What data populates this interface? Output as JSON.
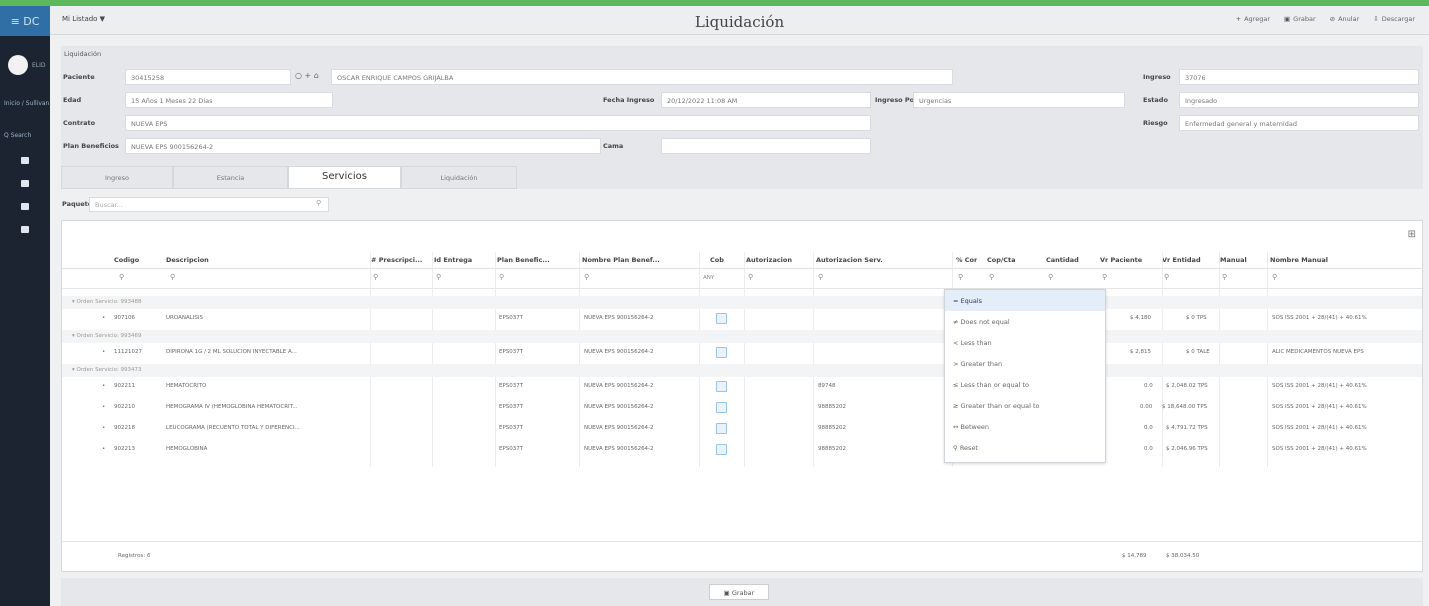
{
  "sidebar": {
    "menu_label": "≡  DC",
    "user": "ELID",
    "links": [
      "Inicio / Sullivan",
      "Q  Search"
    ]
  },
  "titlebar": {
    "left_label": "Mi Listado ▼",
    "title": "Liquidación",
    "actions": [
      "Agregar",
      "Grabar",
      "Anular",
      "Descargar"
    ]
  },
  "form": {
    "panel_title": "Liquidación",
    "labels": {
      "paciente": "Paciente",
      "edad": "Edad",
      "contrato": "Contrato",
      "plan": "Plan Beneficios",
      "fecha_ingreso": "Fecha Ingreso",
      "ingreso_por": "Ingreso Por",
      "cama": "Cama",
      "ingreso": "Ingreso",
      "estado": "Estado",
      "riesgo": "Riesgo"
    },
    "values": {
      "paciente_id": "30415258",
      "paciente_name": "OSCAR ENRIQUE CAMPOS GRIJALBA",
      "edad": "15 Años 1 Meses 22 Días",
      "contrato": "NUEVA EPS",
      "plan": "NUEVA EPS 900156264-2",
      "fecha_ingreso": "20/12/2022 11:08 AM",
      "ingreso_por": "Urgencias",
      "cama": "",
      "ingreso": "37076",
      "estado": "Ingresado",
      "riesgo": "Enfermedad general y maternidad"
    }
  },
  "tabs": [
    "Ingreso",
    "Estancia",
    "Servicios",
    "Liquidación"
  ],
  "search": {
    "label": "Paquete",
    "placeholder": "Buscar..."
  },
  "grid": {
    "columns": [
      "Codigo",
      "Descripcion",
      "# Prescripci...",
      "Id Entrega",
      "Plan Benefic...",
      "Nombre Plan Benef...",
      "Cob",
      "Autorizacion",
      "Autorizacion Serv.",
      "% Cor",
      "Cop/Cta",
      "Cantidad",
      "Vr Paciente",
      "Vr Entidad",
      "Manual",
      "Nombre Manual"
    ],
    "cob_filter": "ANY",
    "groups": [
      {
        "title": "Orden Servicio: 993488",
        "rows": [
          {
            "codigo": "907106",
            "descripcion": "UROANALISIS",
            "plan": "EPS037T",
            "nombre_plan": "NUEVA EPS 900156264-2",
            "autorizacion_serv": "",
            "vr_paciente": "$ 4,180",
            "vr_entidad": "$ 0 TPS",
            "nombre_manual": "SOS ISS 2001 + 28/(41) + 40.61%"
          }
        ]
      },
      {
        "title": "Orden Servicio: 993469",
        "rows": [
          {
            "codigo": "11121027",
            "descripcion": "DIPIRONA 1G / 2 ML SOLUCION INYECTABLE A...",
            "plan": "EPS037T",
            "nombre_plan": "NUEVA EPS 900156264-2",
            "autorizacion_serv": "",
            "vr_paciente": "$ 2,815",
            "vr_entidad": "$ 0 TALE",
            "nombre_manual": "ALIC MEDICAMENTOS NUEVA EPS"
          }
        ]
      },
      {
        "title": "Orden Servicio: 993473",
        "rows": [
          {
            "codigo": "902211",
            "descripcion": "HEMATOCRITO",
            "plan": "EPS037T",
            "nombre_plan": "NUEVA EPS 900156264-2",
            "autorizacion_serv": "89748",
            "cantidad": "0.0",
            "vr_paciente": "",
            "vr_entidad": "$ 2,048.02 TPS",
            "nombre_manual": "SOS ISS 2001 + 28/(41) + 40.61%"
          },
          {
            "codigo": "902210",
            "descripcion": "HEMOGRAMA IV (HEMOGLOBINA HEMATOCRIT...",
            "plan": "EPS037T",
            "nombre_plan": "NUEVA EPS 900156264-2",
            "autorizacion_serv": "98885202",
            "cantidad": "0.00",
            "vr_paciente": "",
            "vr_entidad": "$ 18,648.00 TPS",
            "nombre_manual": "SOS ISS 2001 + 28/(41) + 40.61%"
          },
          {
            "codigo": "902218",
            "descripcion": "LEUCOGRAMA (RECUENTO TOTAL Y DIFERENCI...",
            "plan": "EPS037T",
            "nombre_plan": "NUEVA EPS 900156264-2",
            "autorizacion_serv": "98885202",
            "cantidad": "0.0",
            "vr_paciente": "",
            "vr_entidad": "$ 4,791.72 TPS",
            "nombre_manual": "SOS ISS 2001 + 28/(41) + 40.61%"
          },
          {
            "codigo": "902213",
            "descripcion": "HEMOGLOBINA",
            "plan": "EPS037T",
            "nombre_plan": "NUEVA EPS 900156264-2",
            "autorizacion_serv": "98885202",
            "cantidad": "0.0",
            "vr_paciente": "",
            "vr_entidad": "$ 2,046.96 TPS",
            "nombre_manual": "SOS ISS 2001 + 28/(41) + 40.61%"
          }
        ]
      }
    ],
    "footer": {
      "count": "Registros: 6",
      "total_paciente": "$ 14,789",
      "total_entidad": "$ 38,034.50"
    }
  },
  "filter_menu": {
    "items": [
      "Equals",
      "Does not equal",
      "Less than",
      "Greater than",
      "Less than or equal to",
      "Greater than or equal to",
      "Between",
      "Reset"
    ],
    "selected_index": 0
  },
  "bottom": {
    "save_label": "Grabar"
  }
}
